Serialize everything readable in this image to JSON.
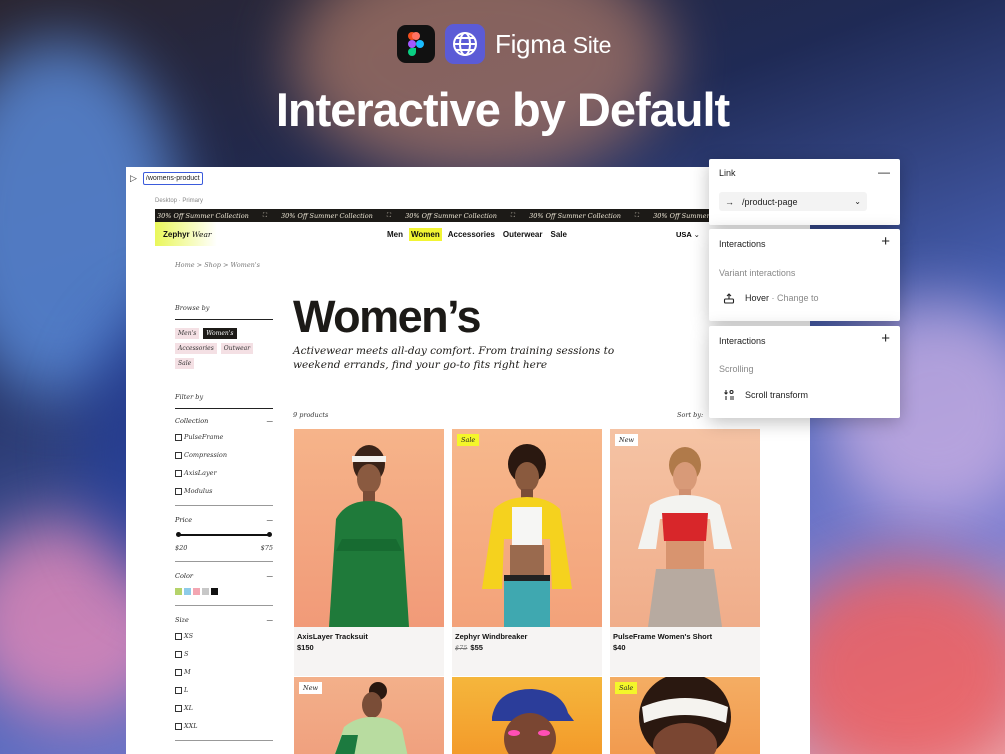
{
  "brand": {
    "name": "Figma",
    "product": "Site"
  },
  "headline": "Interactive by Default",
  "canvas": {
    "url_value": "/womens-products",
    "frame_label": "Desktop · Primary"
  },
  "site": {
    "marquee_text": "30% Off Summer Collection",
    "logo_bold": "Zephyr",
    "logo_italic": "Wear",
    "nav": [
      "Men",
      "Women",
      "Accessories",
      "Outerwear",
      "Sale"
    ],
    "nav_active": "Women",
    "locale": "USA",
    "breadcrumb": [
      "Home",
      "Shop",
      "Women's"
    ],
    "browse_heading": "Browse by",
    "browse_chips": [
      "Men's",
      "Women's",
      "Accessories",
      "Outwear",
      "Sale"
    ],
    "browse_active": "Women's",
    "filter_heading": "Filter by",
    "collection_label": "Collection",
    "collections": [
      "PulseFrame",
      "Compression",
      "AxisLayer",
      "Modulus"
    ],
    "price_label": "Price",
    "price_min": "$20",
    "price_max": "$75",
    "color_label": "Color",
    "colors": [
      "#b5d36a",
      "#8ecbe8",
      "#f3a6b2",
      "#c7c7c7",
      "#111111"
    ],
    "size_label": "Size",
    "sizes": [
      "XS",
      "S",
      "M",
      "L",
      "XL",
      "XXL"
    ],
    "page_title": "Women’s",
    "page_subtitle": "Activewear meets all-day comfort. From training sessions to weekend errands, find your go-to fits right here",
    "product_count": "9 products",
    "sort_label": "Sort by:",
    "products": [
      {
        "name": "AxisLayer Tracksuit",
        "price": "$150",
        "old_price": "",
        "badge": ""
      },
      {
        "name": "Zephyr Windbreaker",
        "price": "$55",
        "old_price": "$75",
        "badge": "Sale"
      },
      {
        "name": "PulseFrame Women's Short",
        "price": "$40",
        "old_price": "",
        "badge": "New"
      },
      {
        "name": "",
        "price": "",
        "old_price": "",
        "badge": "New"
      },
      {
        "name": "",
        "price": "",
        "old_price": "",
        "badge": ""
      },
      {
        "name": "",
        "price": "",
        "old_price": "",
        "badge": "Sale"
      }
    ]
  },
  "link_panel": {
    "title": "Link",
    "value": "/product-page"
  },
  "interactions_panel_1": {
    "title": "Interactions",
    "section": "Variant interactions",
    "trigger": "Hover",
    "action": "Change to"
  },
  "interactions_panel_2": {
    "title": "Interactions",
    "section": "Scrolling",
    "item": "Scroll transform"
  }
}
